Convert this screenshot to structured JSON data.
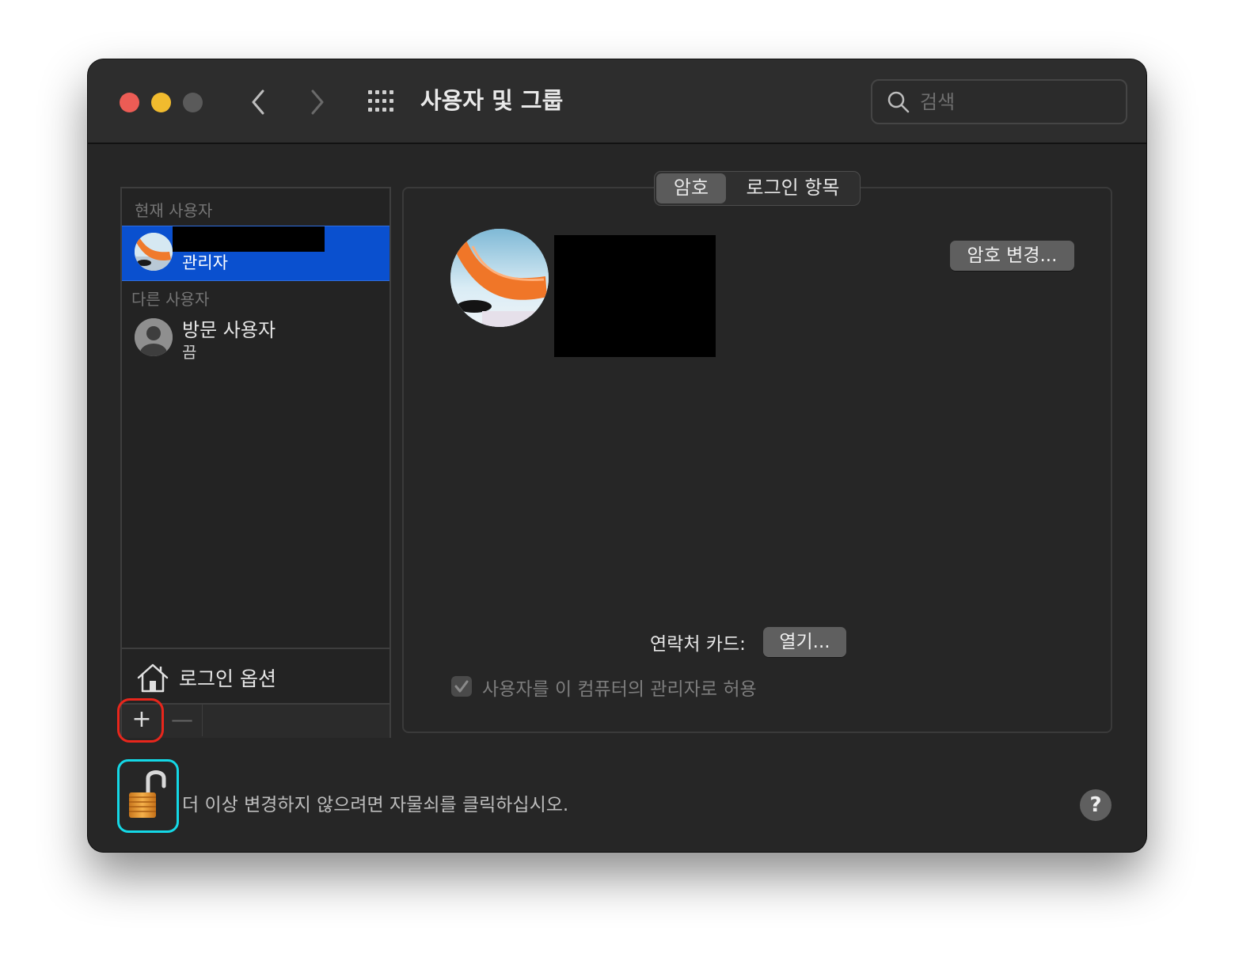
{
  "window": {
    "title": "사용자 및 그룹"
  },
  "search": {
    "placeholder": "검색",
    "value": ""
  },
  "sidebar": {
    "current_users_label": "현재 사용자",
    "current_user": {
      "role": "관리자"
    },
    "other_users_label": "다른 사용자",
    "guest_user": {
      "name": "방문 사용자",
      "status": "끔"
    },
    "login_options_label": "로그인 옵션",
    "add_label": "+",
    "remove_label": "—"
  },
  "tabs": {
    "password": "암호",
    "login_items": "로그인 항목",
    "selected": "암호"
  },
  "main": {
    "change_password_button": "암호 변경...",
    "contact_card_label": "연락처 카드:",
    "open_button": "열기...",
    "allow_admin_label": "사용자를 이 컴퓨터의 관리자로 허용",
    "allow_admin_checked": true
  },
  "footer": {
    "lock_text": "더 이상 변경하지 않으려면 자물쇠를 클릭하십시오.",
    "help_label": "?"
  },
  "colors": {
    "selection": "#0a50cf",
    "close": "#ec5c55",
    "minimize": "#f1bb2e",
    "highlight_red": "#e8261c",
    "highlight_cyan": "#14d8e6"
  },
  "icons": {
    "search": "magnifying-glass",
    "grid": "show-all-grid",
    "back": "chevron-left",
    "forward": "chevron-right",
    "house": "house",
    "lock": "padlock-unlocked",
    "guest": "person-silhouette"
  }
}
